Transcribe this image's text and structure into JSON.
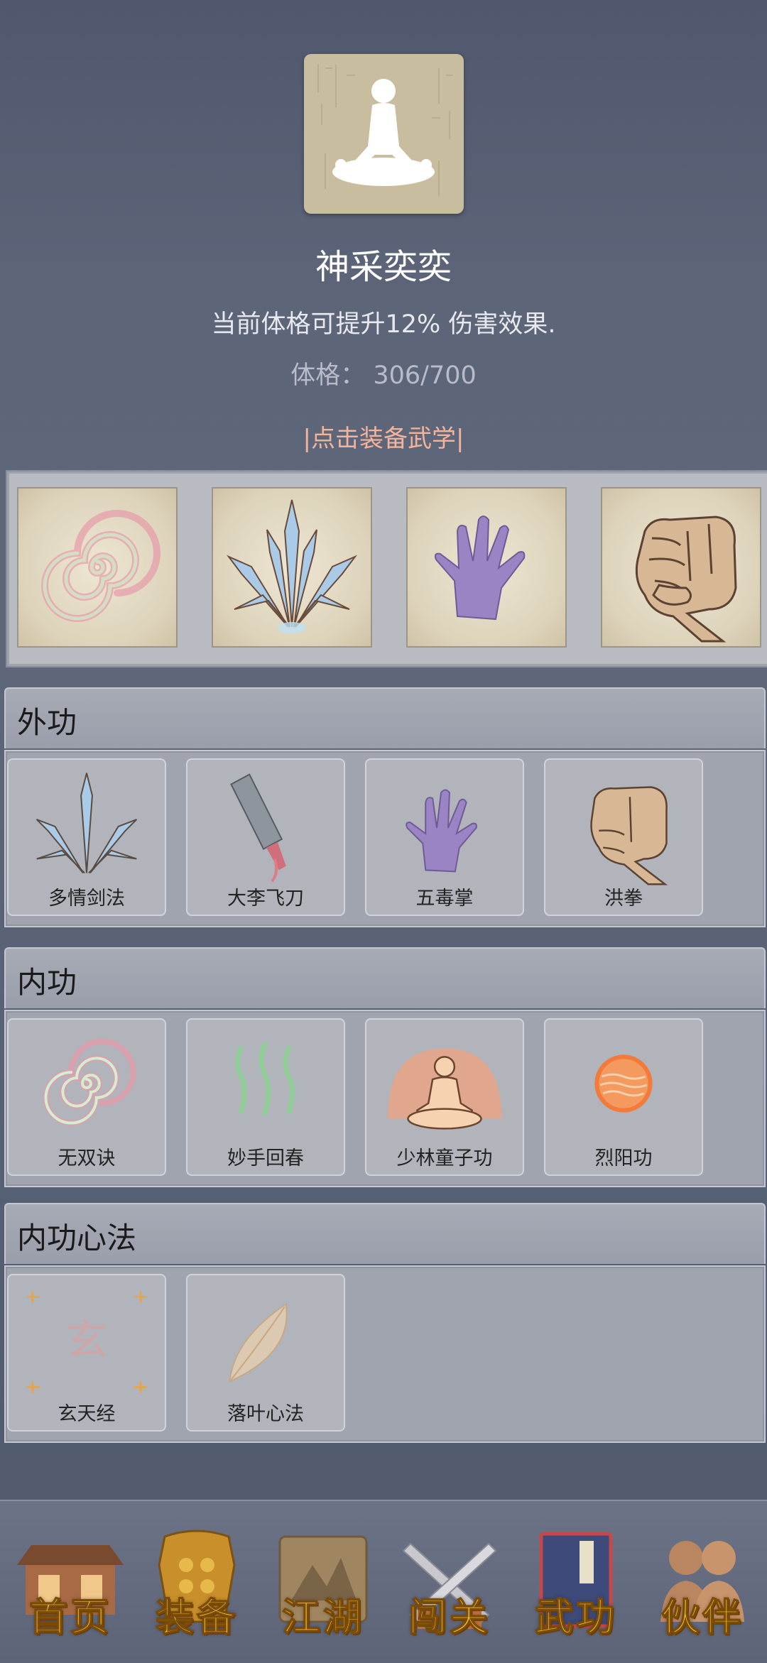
{
  "header": {
    "title": "神采奕奕",
    "description": "当前体格可提升12% 伤害效果.",
    "stat_label": "体格：",
    "stat_value": "306/700",
    "equip_link": "|点击装备武学|"
  },
  "equipped": [
    {
      "icon": "spiral-icon"
    },
    {
      "icon": "sword-fan-icon"
    },
    {
      "icon": "purple-palm-icon"
    },
    {
      "icon": "fist-icon"
    }
  ],
  "sections": {
    "external": {
      "title": "外功",
      "skills": [
        {
          "name": "多情剑法",
          "icon": "sword-fan-icon"
        },
        {
          "name": "大李飞刀",
          "icon": "cleaver-icon"
        },
        {
          "name": "五毒掌",
          "icon": "purple-palm-icon"
        },
        {
          "name": "洪拳",
          "icon": "fist-icon"
        }
      ]
    },
    "internal": {
      "title": "内功",
      "skills": [
        {
          "name": "无双诀",
          "icon": "spiral-icon"
        },
        {
          "name": "妙手回春",
          "icon": "green-waves-icon"
        },
        {
          "name": "少林童子功",
          "icon": "meditating-monk-icon"
        },
        {
          "name": "烈阳功",
          "icon": "sun-orb-icon"
        }
      ]
    },
    "mind": {
      "title": "内功心法",
      "skills": [
        {
          "name": "玄天经",
          "icon": "xuan-glyph-icon",
          "glyph": "玄"
        },
        {
          "name": "落叶心法",
          "icon": "leaf-icon"
        }
      ]
    }
  },
  "nav": [
    {
      "label": "首页",
      "icon": "house-icon"
    },
    {
      "label": "装备",
      "icon": "armor-icon"
    },
    {
      "label": "江湖",
      "icon": "scroll-map-icon"
    },
    {
      "label": "闯关",
      "icon": "crossed-swords-icon"
    },
    {
      "label": "武功",
      "icon": "martial-book-icon"
    },
    {
      "label": "伙伴",
      "icon": "companions-icon"
    }
  ],
  "colors": {
    "link": "#f3b49c",
    "nav_label": "#f1c232",
    "background": "#5d6579"
  }
}
